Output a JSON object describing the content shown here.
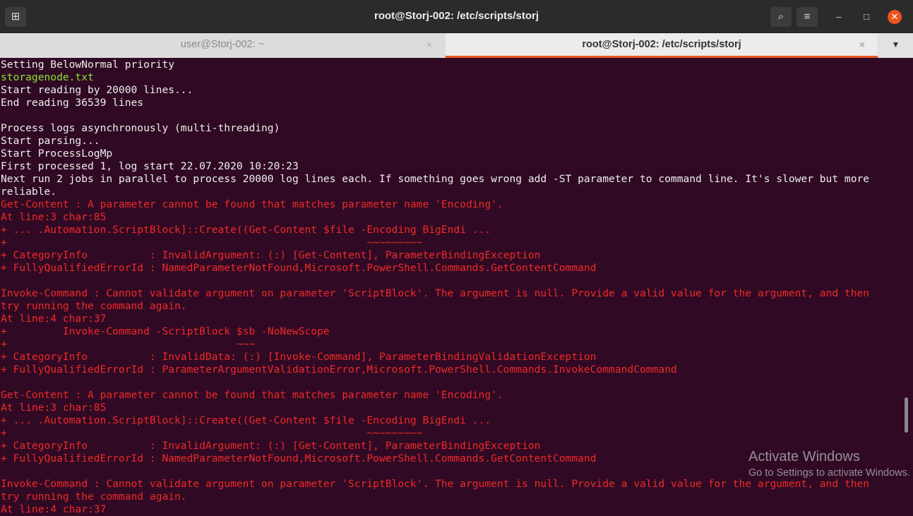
{
  "window": {
    "title": "root@Storj-002: /etc/scripts/storj"
  },
  "tabs": [
    {
      "label": "user@Storj-002: ~"
    },
    {
      "label": "root@Storj-002: /etc/scripts/storj"
    }
  ],
  "icons": {
    "new_tab": "⊞",
    "search": "⌕",
    "menu": "≡",
    "minimize": "–",
    "maximize": "□",
    "close": "✕",
    "tab_close": "×",
    "tab_menu": "▼"
  },
  "terminal": {
    "lines": [
      {
        "t": "Setting BelowNormal priority",
        "c": ""
      },
      {
        "t": "storagenode.txt",
        "c": "g"
      },
      {
        "t": "Start reading by 20000 lines...",
        "c": ""
      },
      {
        "t": "End reading 36539 lines",
        "c": ""
      },
      {
        "t": "",
        "c": ""
      },
      {
        "t": "Process logs asynchronously (multi-threading)",
        "c": ""
      },
      {
        "t": "Start parsing...",
        "c": ""
      },
      {
        "t": "Start ProcessLogMp",
        "c": ""
      },
      {
        "t": "First processed 1, log start 22.07.2020 10:20:23",
        "c": ""
      },
      {
        "t": "Next run 2 jobs in parallel to process 20000 log lines each. If something goes wrong add -ST parameter to command line. It's slower but more",
        "c": ""
      },
      {
        "t": "reliable.",
        "c": ""
      },
      {
        "t": "Get-Content : A parameter cannot be found that matches parameter name 'Encoding'.",
        "c": "r"
      },
      {
        "t": "At line:3 char:85",
        "c": "r"
      },
      {
        "t": "+ ... .Automation.ScriptBlock]::Create((Get-Content $file -Encoding BigEndi ...",
        "c": "r"
      },
      {
        "t": "+                                                          ~~~~~~~~~",
        "c": "r"
      },
      {
        "t": "+ CategoryInfo          : InvalidArgument: (:) [Get-Content], ParameterBindingException",
        "c": "r"
      },
      {
        "t": "+ FullyQualifiedErrorId : NamedParameterNotFound,Microsoft.PowerShell.Commands.GetContentCommand",
        "c": "r"
      },
      {
        "t": "",
        "c": ""
      },
      {
        "t": "Invoke-Command : Cannot validate argument on parameter 'ScriptBlock'. The argument is null. Provide a valid value for the argument, and then",
        "c": "r"
      },
      {
        "t": "try running the command again.",
        "c": "r"
      },
      {
        "t": "At line:4 char:37",
        "c": "r"
      },
      {
        "t": "+         Invoke-Command -ScriptBlock $sb -NoNewScope",
        "c": "r"
      },
      {
        "t": "+                                     ~~~",
        "c": "r"
      },
      {
        "t": "+ CategoryInfo          : InvalidData: (:) [Invoke-Command], ParameterBindingValidationException",
        "c": "r"
      },
      {
        "t": "+ FullyQualifiedErrorId : ParameterArgumentValidationError,Microsoft.PowerShell.Commands.InvokeCommandCommand",
        "c": "r"
      },
      {
        "t": "",
        "c": ""
      },
      {
        "t": "Get-Content : A parameter cannot be found that matches parameter name 'Encoding'.",
        "c": "r"
      },
      {
        "t": "At line:3 char:85",
        "c": "r"
      },
      {
        "t": "+ ... .Automation.ScriptBlock]::Create((Get-Content $file -Encoding BigEndi ...",
        "c": "r"
      },
      {
        "t": "+                                                          ~~~~~~~~~",
        "c": "r"
      },
      {
        "t": "+ CategoryInfo          : InvalidArgument: (:) [Get-Content], ParameterBindingException",
        "c": "r"
      },
      {
        "t": "+ FullyQualifiedErrorId : NamedParameterNotFound,Microsoft.PowerShell.Commands.GetContentCommand",
        "c": "r"
      },
      {
        "t": "",
        "c": ""
      },
      {
        "t": "Invoke-Command : Cannot validate argument on parameter 'ScriptBlock'. The argument is null. Provide a valid value for the argument, and then",
        "c": "r"
      },
      {
        "t": "try running the command again.",
        "c": "r"
      },
      {
        "t": "At line:4 char:37",
        "c": "r"
      }
    ]
  },
  "watermark": {
    "title": "Activate Windows",
    "subtitle": "Go to Settings to activate Windows."
  }
}
